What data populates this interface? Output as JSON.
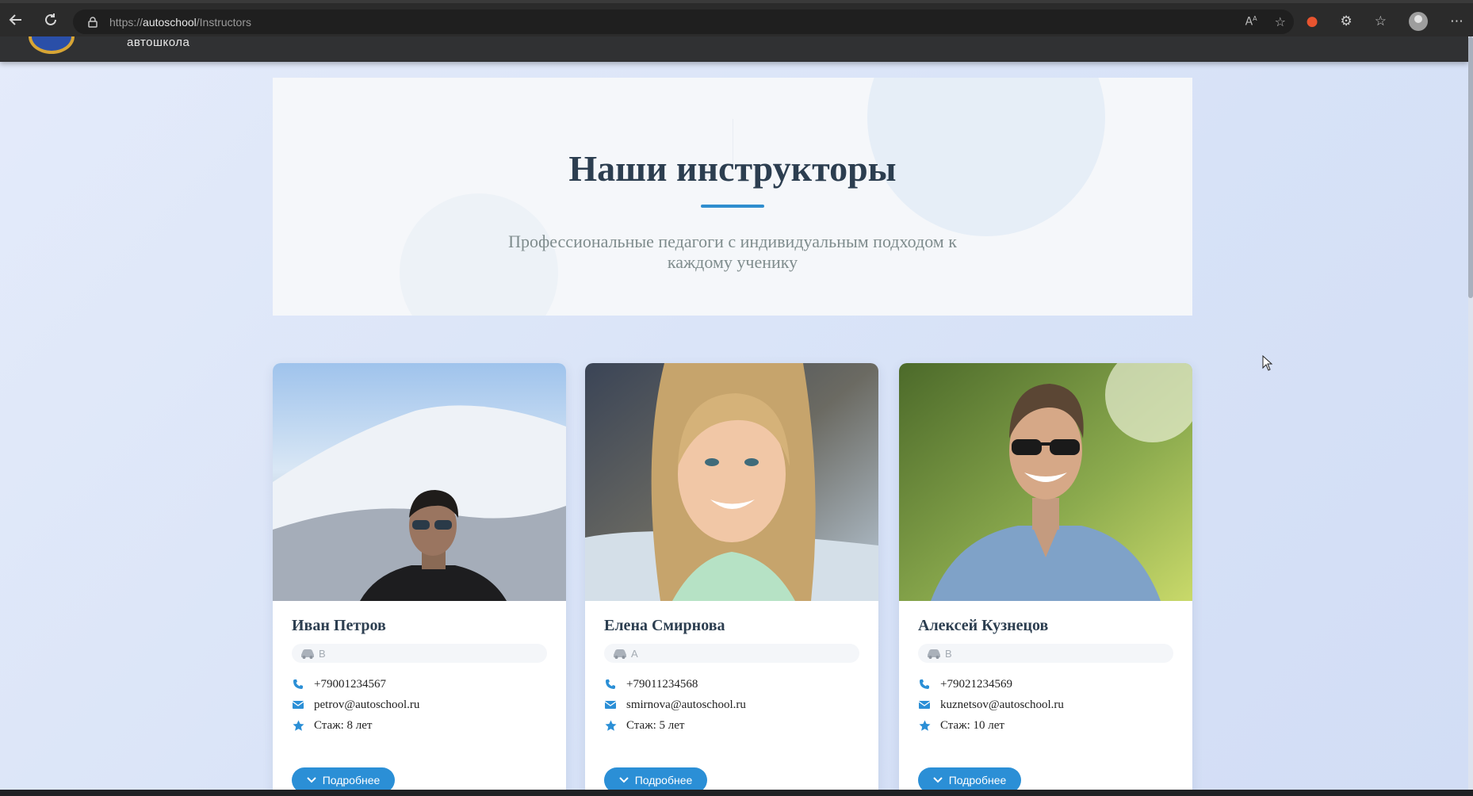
{
  "browser": {
    "url_prefix": "https://",
    "url_host": "autoschool",
    "url_path": "/Instructors",
    "icons": [
      "back-icon",
      "reload-icon",
      "lock-icon",
      "read-aloud-icon",
      "favorite-star-icon",
      "extension-flame-icon",
      "extensions-puzzle-icon",
      "favorites-list-icon",
      "profile-icon",
      "more-icon"
    ]
  },
  "site": {
    "name": "автошкола"
  },
  "hero": {
    "title": "Наши инструкторы",
    "subtitle": "Профессиональные педагоги с индивидуальным подходом к каждому ученику"
  },
  "instructors": [
    {
      "name": "Иван Петров",
      "category": "B",
      "phone": "+79001234567",
      "email": "petrov@autoschool.ru",
      "experience": "Стаж: 8 лет",
      "button": "Подробнее"
    },
    {
      "name": "Елена Смирнова",
      "category": "A",
      "phone": "+79011234568",
      "email": "smirnova@autoschool.ru",
      "experience": "Стаж: 5 лет",
      "button": "Подробнее"
    },
    {
      "name": "Алексей Кузнецов",
      "category": "B",
      "phone": "+79021234569",
      "email": "kuznetsov@autoschool.ru",
      "experience": "Стаж: 10 лет",
      "button": "Подробнее"
    }
  ],
  "colors": {
    "accent": "#2b8fd6",
    "title": "#2c3e50",
    "page_bg": "#dde6f8"
  }
}
